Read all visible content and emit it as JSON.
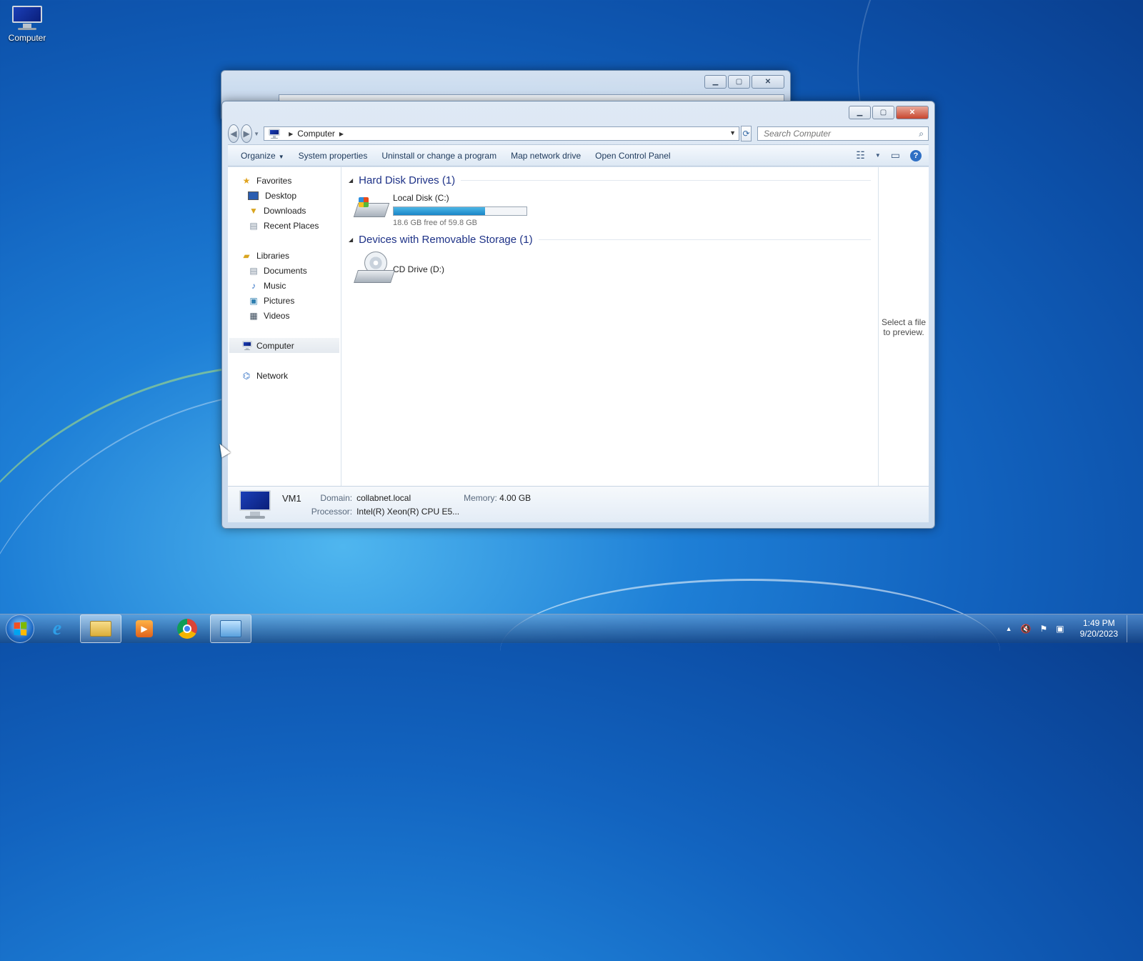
{
  "desktop": {
    "icon_label": "Computer"
  },
  "explorer": {
    "address": {
      "location": "Computer"
    },
    "search": {
      "placeholder": "Search Computer"
    },
    "toolbar": {
      "organize": "Organize",
      "system_properties": "System properties",
      "uninstall": "Uninstall or change a program",
      "map_drive": "Map network drive",
      "control_panel": "Open Control Panel"
    },
    "nav": {
      "favorites": "Favorites",
      "desktop": "Desktop",
      "downloads": "Downloads",
      "recent": "Recent Places",
      "libraries": "Libraries",
      "documents": "Documents",
      "music": "Music",
      "pictures": "Pictures",
      "videos": "Videos",
      "computer": "Computer",
      "network": "Network"
    },
    "groups": {
      "hdd_header": "Hard Disk Drives (1)",
      "removable_header": "Devices with Removable Storage (1)"
    },
    "drives": {
      "c_name": "Local Disk (C:)",
      "c_free": "18.6 GB free of 59.8 GB",
      "c_used_fraction": 0.69,
      "d_name": "CD Drive (D:)"
    },
    "preview_text": "Select a file to preview.",
    "details": {
      "name": "VM1",
      "domain_label": "Domain:",
      "domain": "collabnet.local",
      "memory_label": "Memory:",
      "memory": "4.00 GB",
      "processor_label": "Processor:",
      "processor": "Intel(R) Xeon(R) CPU E5..."
    }
  },
  "taskbar": {
    "time": "1:49 PM",
    "date": "9/20/2023"
  },
  "colors": {
    "accent": "#1e3287",
    "bar_fill": "#1a86c8"
  }
}
